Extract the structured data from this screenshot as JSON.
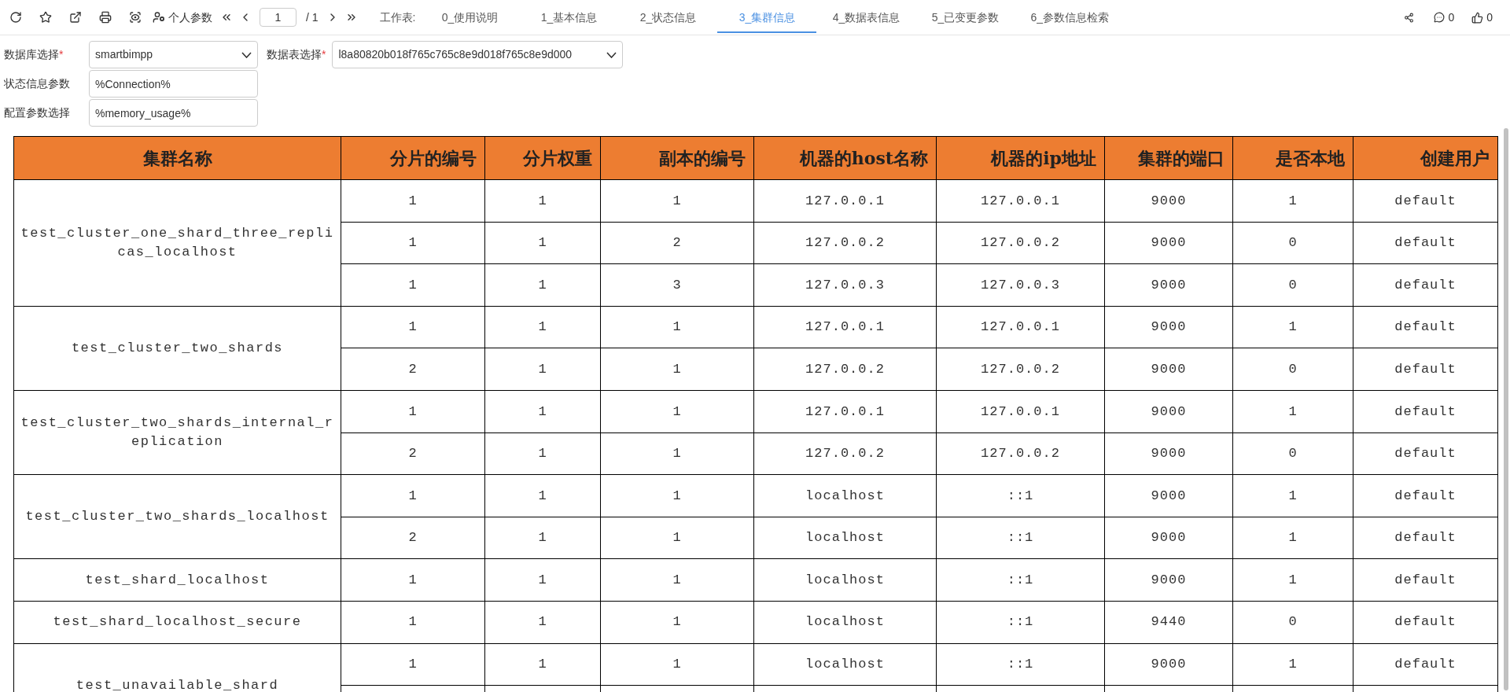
{
  "toolbar": {
    "personal_params": "个人参数",
    "page_input": "1",
    "page_total": "/ 1",
    "sheet_label": "工作表:",
    "tabs": [
      {
        "label": "0_使用说明",
        "selected": false
      },
      {
        "label": "1_基本信息",
        "selected": false
      },
      {
        "label": "2_状态信息",
        "selected": false
      },
      {
        "label": "3_集群信息",
        "selected": true
      },
      {
        "label": "4_数据表信息",
        "selected": false
      },
      {
        "label": "5_已变更参数",
        "selected": false
      },
      {
        "label": "6_参数信息检索",
        "selected": false
      }
    ],
    "comments": "0",
    "likes": "0"
  },
  "filters": [
    {
      "kind": "select",
      "label": "数据库选择",
      "required_mark": "*",
      "value": "smartbimpp"
    },
    {
      "kind": "select",
      "label": "数据表选择",
      "required_mark": "*",
      "value": "l8a80820b018f765c765c8e9d018f765c8e9d000"
    },
    {
      "kind": "text",
      "label": "状态信息参数",
      "value": "%Connection%"
    },
    {
      "kind": "text",
      "label": "配置参数选择",
      "value": "%memory_usage%"
    }
  ],
  "table": {
    "columns": [
      "集群名称",
      "分片的编号",
      "分片权重",
      "副本的编号",
      "机器的host名称",
      "机器的ip地址",
      "集群的端口",
      "是否本地",
      "创建用户"
    ],
    "groups": [
      {
        "cluster": "test_cluster_one_shard_three_replicas_localhost",
        "rows": [
          [
            "1",
            "1",
            "1",
            "127.0.0.1",
            "127.0.0.1",
            "9000",
            "1",
            "default"
          ],
          [
            "1",
            "1",
            "2",
            "127.0.0.2",
            "127.0.0.2",
            "9000",
            "0",
            "default"
          ],
          [
            "1",
            "1",
            "3",
            "127.0.0.3",
            "127.0.0.3",
            "9000",
            "0",
            "default"
          ]
        ]
      },
      {
        "cluster": "test_cluster_two_shards",
        "rows": [
          [
            "1",
            "1",
            "1",
            "127.0.0.1",
            "127.0.0.1",
            "9000",
            "1",
            "default"
          ],
          [
            "2",
            "1",
            "1",
            "127.0.0.2",
            "127.0.0.2",
            "9000",
            "0",
            "default"
          ]
        ]
      },
      {
        "cluster": "test_cluster_two_shards_internal_replication",
        "rows": [
          [
            "1",
            "1",
            "1",
            "127.0.0.1",
            "127.0.0.1",
            "9000",
            "1",
            "default"
          ],
          [
            "2",
            "1",
            "1",
            "127.0.0.2",
            "127.0.0.2",
            "9000",
            "0",
            "default"
          ]
        ]
      },
      {
        "cluster": "test_cluster_two_shards_localhost",
        "rows": [
          [
            "1",
            "1",
            "1",
            "localhost",
            "::1",
            "9000",
            "1",
            "default"
          ],
          [
            "2",
            "1",
            "1",
            "localhost",
            "::1",
            "9000",
            "1",
            "default"
          ]
        ]
      },
      {
        "cluster": "test_shard_localhost",
        "rows": [
          [
            "1",
            "1",
            "1",
            "localhost",
            "::1",
            "9000",
            "1",
            "default"
          ]
        ]
      },
      {
        "cluster": "test_shard_localhost_secure",
        "rows": [
          [
            "1",
            "1",
            "1",
            "localhost",
            "::1",
            "9440",
            "0",
            "default"
          ]
        ]
      },
      {
        "cluster": "test_unavailable_shard",
        "rows": [
          [
            "1",
            "1",
            "1",
            "localhost",
            "::1",
            "9000",
            "1",
            "default"
          ]
        ]
      }
    ]
  }
}
